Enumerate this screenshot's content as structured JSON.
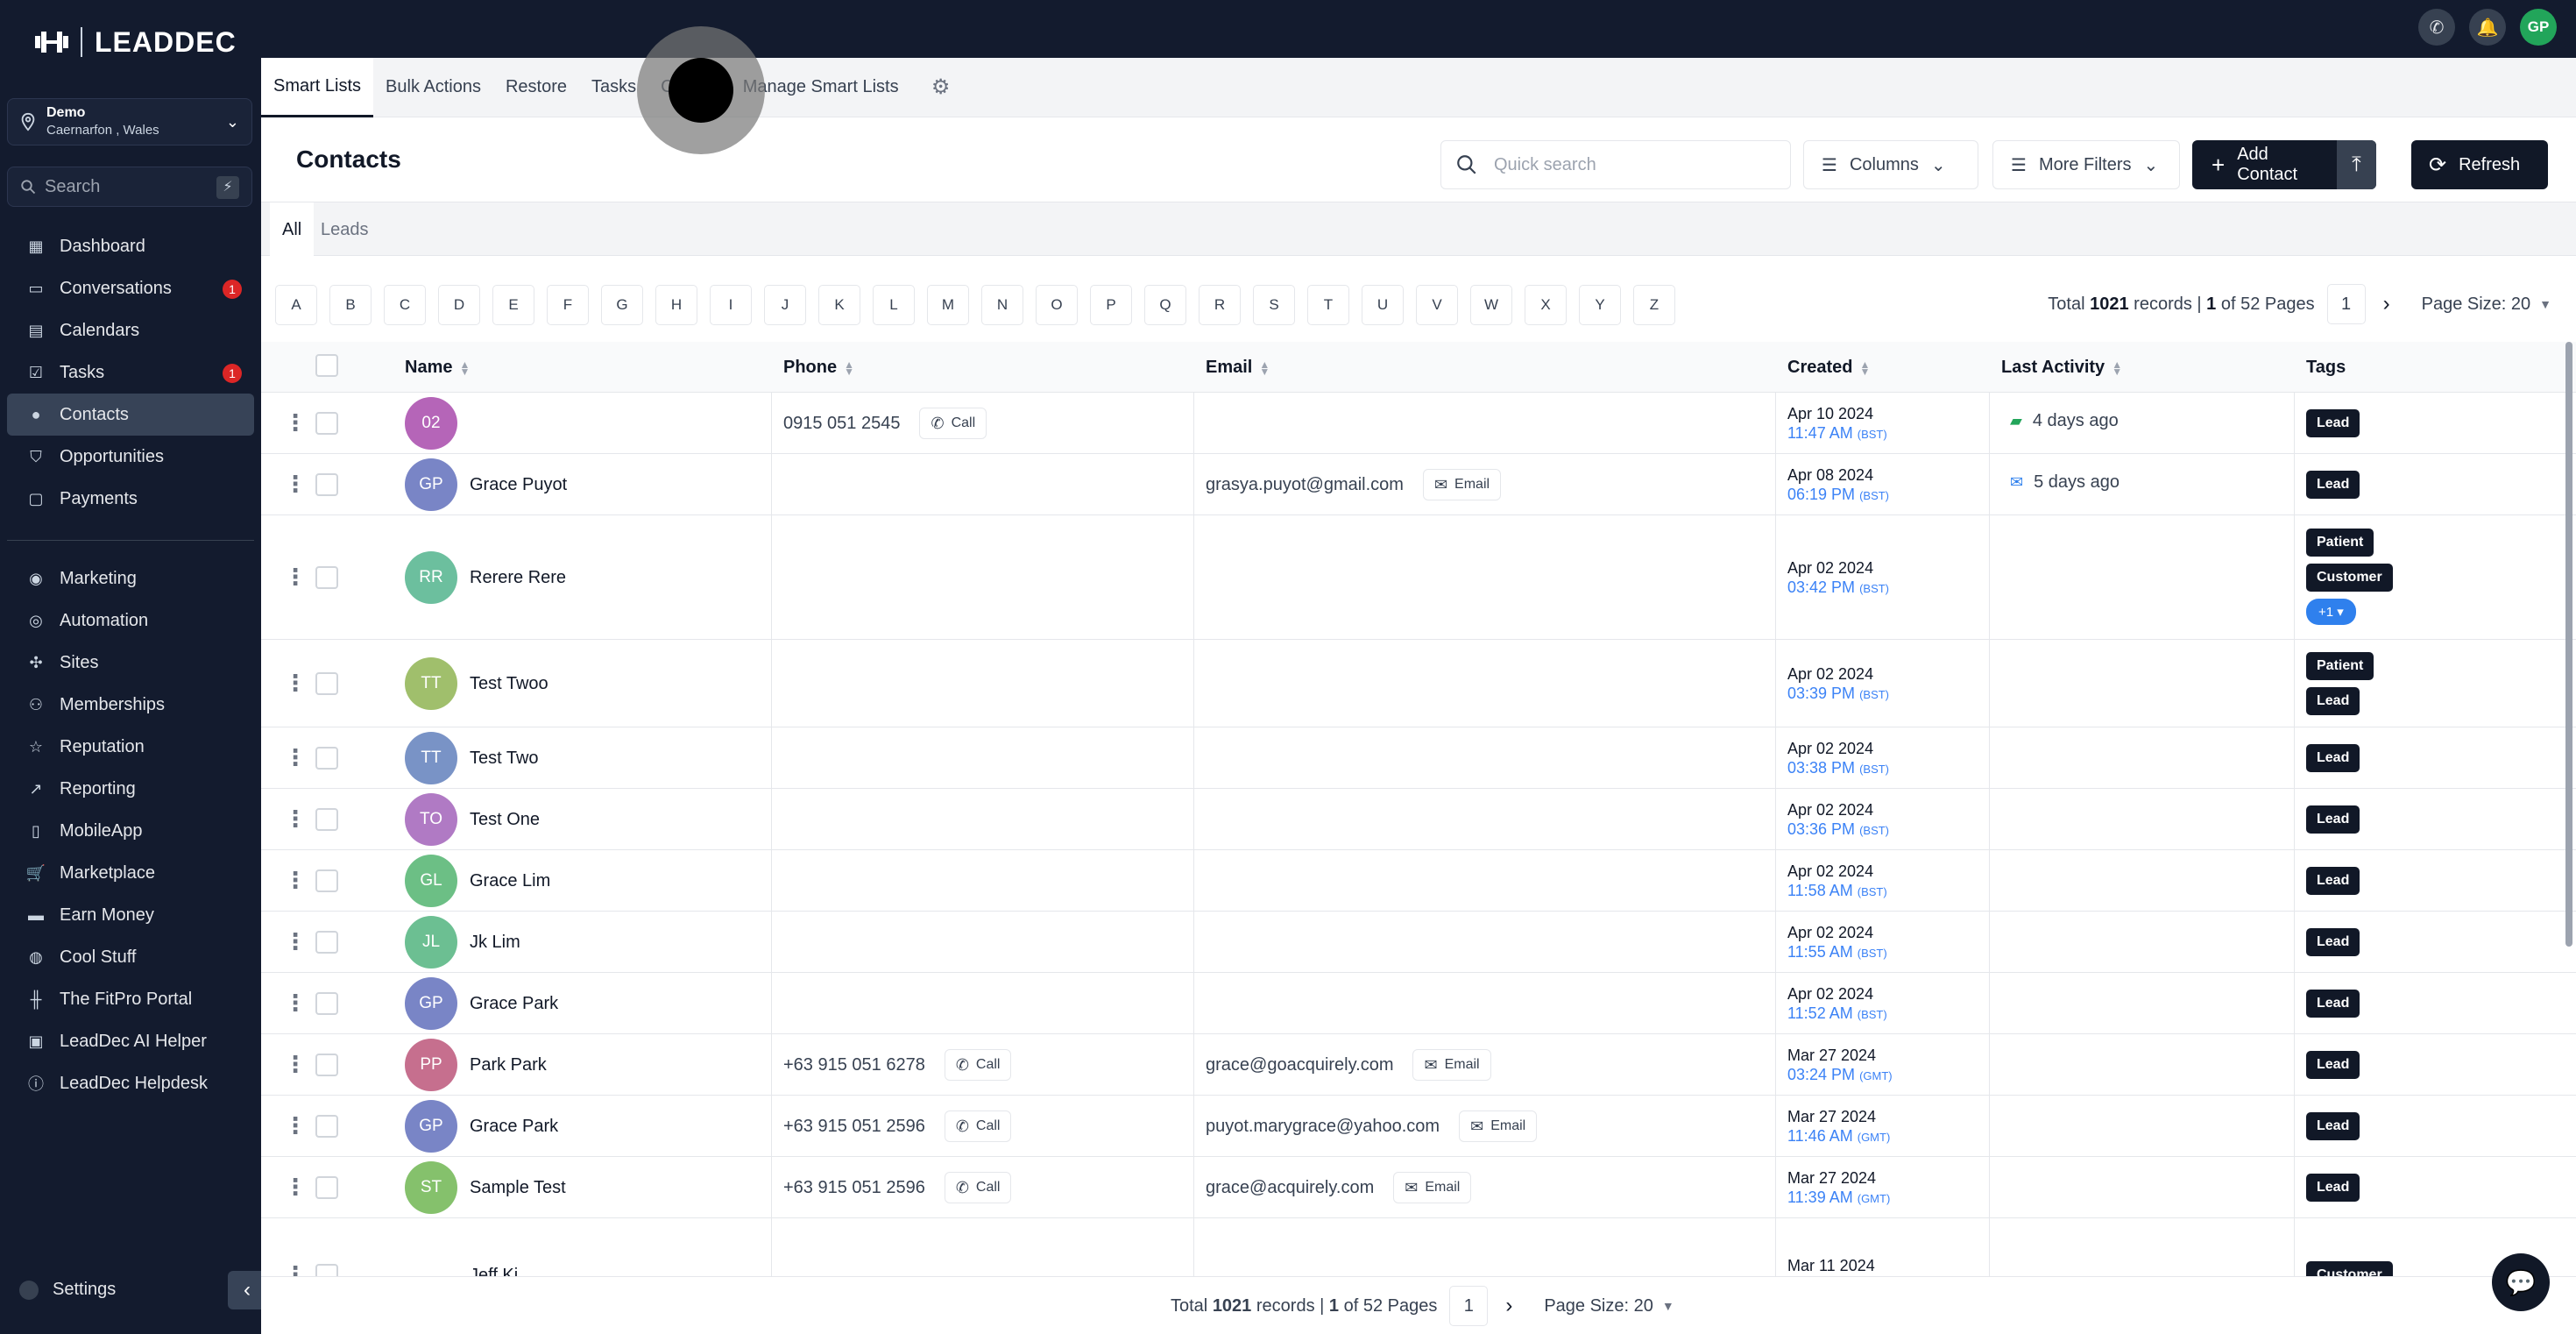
{
  "brand": {
    "name": "LEADDEC"
  },
  "location": {
    "name": "Demo",
    "sub": "Caernarfon , Wales"
  },
  "sidebar": {
    "search_placeholder": "Search",
    "items": [
      {
        "label": "Dashboard",
        "icon": "dashboard-icon"
      },
      {
        "label": "Conversations",
        "icon": "chat-icon",
        "badge": "1"
      },
      {
        "label": "Calendars",
        "icon": "calendar-icon"
      },
      {
        "label": "Tasks",
        "icon": "checkbox-icon",
        "badge": "1"
      },
      {
        "label": "Contacts",
        "icon": "person-icon",
        "active": true
      },
      {
        "label": "Opportunities",
        "icon": "funnel-icon"
      },
      {
        "label": "Payments",
        "icon": "payment-icon"
      }
    ],
    "items2": [
      {
        "label": "Marketing",
        "icon": "megaphone-icon"
      },
      {
        "label": "Automation",
        "icon": "automation-icon"
      },
      {
        "label": "Sites",
        "icon": "sites-icon"
      },
      {
        "label": "Memberships",
        "icon": "members-icon"
      },
      {
        "label": "Reputation",
        "icon": "star-icon"
      },
      {
        "label": "Reporting",
        "icon": "chart-icon"
      },
      {
        "label": "MobileApp",
        "icon": "mobile-icon"
      },
      {
        "label": "Marketplace",
        "icon": "cart-icon"
      },
      {
        "label": "Earn Money",
        "icon": "money-icon"
      },
      {
        "label": "Cool Stuff",
        "icon": "flame-icon"
      },
      {
        "label": "The FitPro Portal",
        "icon": "dumbbell-icon"
      },
      {
        "label": "LeadDec AI Helper",
        "icon": "robot-icon"
      },
      {
        "label": "LeadDec Helpdesk",
        "icon": "info-icon"
      }
    ],
    "settings_label": "Settings"
  },
  "topbar": {
    "avatar": "GP"
  },
  "subtabs": [
    "Smart Lists",
    "Bulk Actions",
    "Restore",
    "Tasks",
    "Co",
    "Manage Smart Lists"
  ],
  "header": {
    "title": "Contacts",
    "search_placeholder": "Quick search",
    "columns_label": "Columns",
    "filters_label": "More Filters",
    "add_label": "Add Contact",
    "refresh_label": "Refresh"
  },
  "segments": [
    "All",
    "Leads"
  ],
  "letters": [
    "A",
    "B",
    "C",
    "D",
    "E",
    "F",
    "G",
    "H",
    "I",
    "J",
    "K",
    "L",
    "M",
    "N",
    "O",
    "P",
    "Q",
    "R",
    "S",
    "T",
    "U",
    "V",
    "W",
    "X",
    "Y",
    "Z"
  ],
  "pager": {
    "prefix": "Total",
    "total": "1021",
    "mid": "records |",
    "page": "1",
    "of": "of 52 Pages",
    "current": "1",
    "size_label": "Page Size: 20"
  },
  "table": {
    "headers": {
      "name": "Name",
      "phone": "Phone",
      "email": "Email",
      "created": "Created",
      "activity": "Last Activity",
      "tags": "Tags"
    },
    "call_label": "Call",
    "email_label": "Email",
    "rows": [
      {
        "initials": "02",
        "color": "#b565b8",
        "name": "",
        "phone": "0915 051 2545",
        "email": "",
        "date": "Apr 10 2024",
        "time": "11:47 AM",
        "tz": "(BST)",
        "activity": "4 days ago",
        "activity_icon": "sms-icon",
        "tags": [
          "Lead"
        ]
      },
      {
        "initials": "GP",
        "color": "#7985c6",
        "name": "Grace Puyot",
        "phone": "",
        "email": "grasya.puyot@gmail.com",
        "date": "Apr 08 2024",
        "time": "06:19 PM",
        "tz": "(BST)",
        "activity": "5 days ago",
        "activity_icon": "mail-icon",
        "tags": [
          "Lead"
        ]
      },
      {
        "initials": "RR",
        "color": "#6cbf9e",
        "name": "Rerere Rere",
        "phone": "",
        "email": "",
        "date": "Apr 02 2024",
        "time": "03:42 PM",
        "tz": "(BST)",
        "activity": "",
        "tags": [
          "Patient",
          "Customer"
        ],
        "more": "+1"
      },
      {
        "initials": "TT",
        "color": "#a0bf6c",
        "name": "Test Twoo",
        "phone": "",
        "email": "",
        "date": "Apr 02 2024",
        "time": "03:39 PM",
        "tz": "(BST)",
        "activity": "",
        "tags": [
          "Patient",
          "Lead"
        ]
      },
      {
        "initials": "TT",
        "color": "#7993c6",
        "name": "Test Two",
        "phone": "",
        "email": "",
        "date": "Apr 02 2024",
        "time": "03:38 PM",
        "tz": "(BST)",
        "activity": "",
        "tags": [
          "Lead"
        ]
      },
      {
        "initials": "TO",
        "color": "#b07ac4",
        "name": "Test One",
        "phone": "",
        "email": "",
        "date": "Apr 02 2024",
        "time": "03:36 PM",
        "tz": "(BST)",
        "activity": "",
        "tags": [
          "Lead"
        ]
      },
      {
        "initials": "GL",
        "color": "#6cbf85",
        "name": "Grace Lim",
        "phone": "",
        "email": "",
        "date": "Apr 02 2024",
        "time": "11:58 AM",
        "tz": "(BST)",
        "activity": "",
        "tags": [
          "Lead"
        ]
      },
      {
        "initials": "JL",
        "color": "#6cbf92",
        "name": "Jk Lim",
        "phone": "",
        "email": "",
        "date": "Apr 02 2024",
        "time": "11:55 AM",
        "tz": "(BST)",
        "activity": "",
        "tags": [
          "Lead"
        ]
      },
      {
        "initials": "GP",
        "color": "#7985c6",
        "name": "Grace Park",
        "phone": "",
        "email": "",
        "date": "Apr 02 2024",
        "time": "11:52 AM",
        "tz": "(BST)",
        "activity": "",
        "tags": [
          "Lead"
        ]
      },
      {
        "initials": "PP",
        "color": "#c66f8e",
        "name": "Park Park",
        "phone": "+63 915 051 6278",
        "email": "grace@goacquirely.com",
        "date": "Mar 27 2024",
        "time": "03:24 PM",
        "tz": "(GMT)",
        "activity": "",
        "tags": [
          "Lead"
        ]
      },
      {
        "initials": "GP",
        "color": "#7985c6",
        "name": "Grace Park",
        "phone": "+63 915 051 2596",
        "email": "puyot.marygrace@yahoo.com",
        "date": "Mar 27 2024",
        "time": "11:46 AM",
        "tz": "(GMT)",
        "activity": "",
        "tags": [
          "Lead"
        ]
      },
      {
        "initials": "ST",
        "color": "#85c16c",
        "name": "Sample Test",
        "phone": "+63 915 051 2596",
        "email": "grace@acquirely.com",
        "date": "Mar 27 2024",
        "time": "11:39 AM",
        "tz": "(GMT)",
        "activity": "",
        "tags": [
          "Lead"
        ]
      },
      {
        "initials": "",
        "color": "#ffffff",
        "name": "Jeff Ki...",
        "phone": "",
        "email": "",
        "date": "Mar 11 2024",
        "time": "",
        "tz": "",
        "activity": "",
        "tags": [
          "Customer"
        ]
      }
    ]
  }
}
